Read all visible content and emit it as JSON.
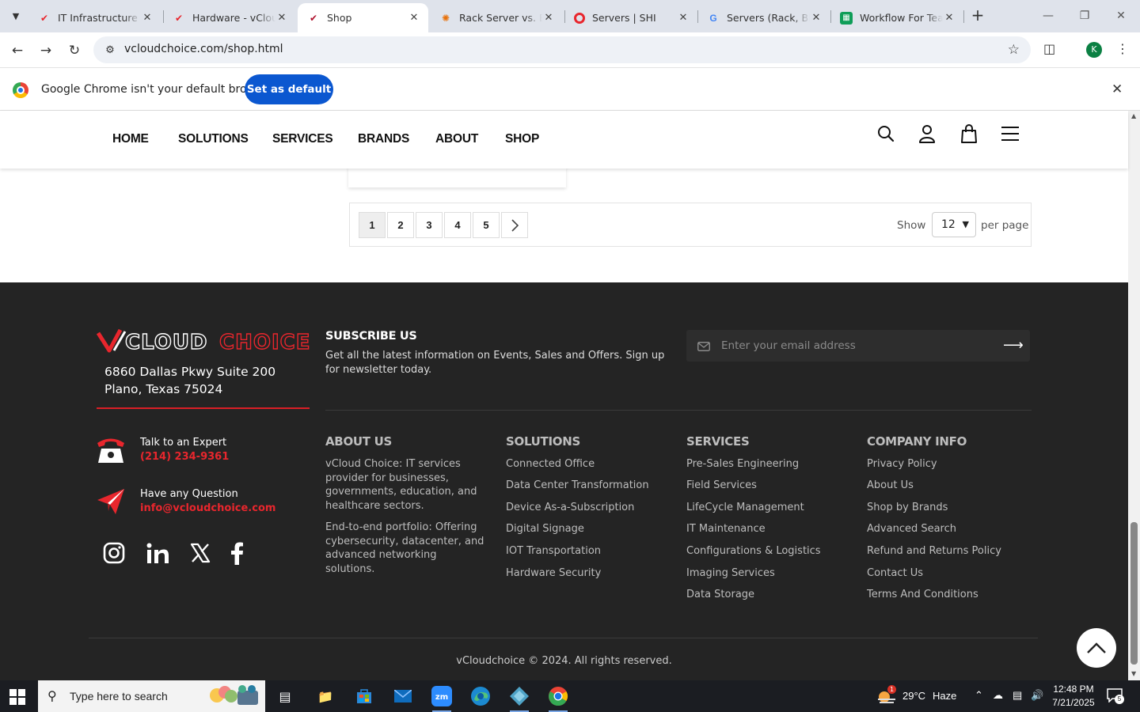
{
  "browser": {
    "tabs": [
      {
        "label": "IT Infrastructure &",
        "favicon": "vcloud-logo-icon"
      },
      {
        "label": "Hardware - vCloud",
        "favicon": "vcloud-logo-icon"
      },
      {
        "label": "Shop",
        "favicon": "vcloud-v-icon",
        "active": true
      },
      {
        "label": "Rack Server vs. Bla",
        "favicon": "blog-icon"
      },
      {
        "label": "Servers | SHI",
        "favicon": "shi-icon"
      },
      {
        "label": "Servers (Rack, Blac",
        "favicon": "google-icon"
      },
      {
        "label": "Workflow For Tean",
        "favicon": "sheets-icon"
      }
    ],
    "url": "vcloudchoice.com/shop.html",
    "profile_initial": "K",
    "infobar": {
      "message": "Google Chrome isn't your default browser",
      "button": "Set as default"
    }
  },
  "site": {
    "nav": [
      "HOME",
      "SOLUTIONS",
      "SERVICES",
      "BRANDS",
      "ABOUT",
      "SHOP"
    ],
    "pagination": {
      "pages": [
        "1",
        "2",
        "3",
        "4",
        "5"
      ],
      "current": "1",
      "next_icon": "chevron-right-icon",
      "show_label": "Show",
      "per_page_value": "12",
      "per_page_label": "per page"
    },
    "footer": {
      "logo_text": "VCLOUDCHOICE",
      "address_line1": "6860 Dallas Pkwy Suite 200",
      "address_line2": "Plano, Texas 75024",
      "phone_label": "Talk to an Expert",
      "phone": "(214) 234-9361",
      "email_label": "Have any Question",
      "email": "info@vcloudchoice.com",
      "subscribe_title": "SUBSCRIBE US",
      "subscribe_desc": "Get all the latest information on Events, Sales and Offers. Sign up for newsletter today.",
      "email_placeholder": "Enter your email address",
      "about": {
        "title": "ABOUT US",
        "p1": "vCloud Choice: IT services provider for businesses, governments, education, and healthcare sectors.",
        "p2": "End-to-end portfolio: Offering cybersecurity, datacenter, and advanced networking solutions."
      },
      "solutions": {
        "title": "SOLUTIONS",
        "links": [
          "Connected Office",
          "Data Center Transformation",
          "Device As-a-Subscription",
          "Digital Signage",
          "IOT Transportation",
          "Hardware Security"
        ]
      },
      "services": {
        "title": "SERVICES",
        "links": [
          "Pre-Sales Engineering",
          "Field Services",
          "LifeCycle Management",
          "IT Maintenance",
          "Configurations & Logistics",
          "Imaging Services",
          "Data Storage"
        ]
      },
      "company": {
        "title": "COMPANY INFO",
        "links": [
          "Privacy Policy",
          "About Us",
          "Shop by Brands",
          "Advanced Search",
          "Refund and Returns Policy",
          "Contact Us",
          "Terms And Conditions"
        ]
      },
      "copyright": "vCloudchoice © 2024. All rights reserved."
    }
  },
  "taskbar": {
    "search_placeholder": "Type here to search",
    "weather_temp": "29°C",
    "weather_desc": "Haze",
    "weather_badge": "1",
    "time": "12:48 PM",
    "date": "7/21/2025",
    "notification_count": "5"
  },
  "colors": {
    "brand_red": "#e8262d",
    "footer_bg": "#242424",
    "chrome_blue": "#0b57d0"
  }
}
